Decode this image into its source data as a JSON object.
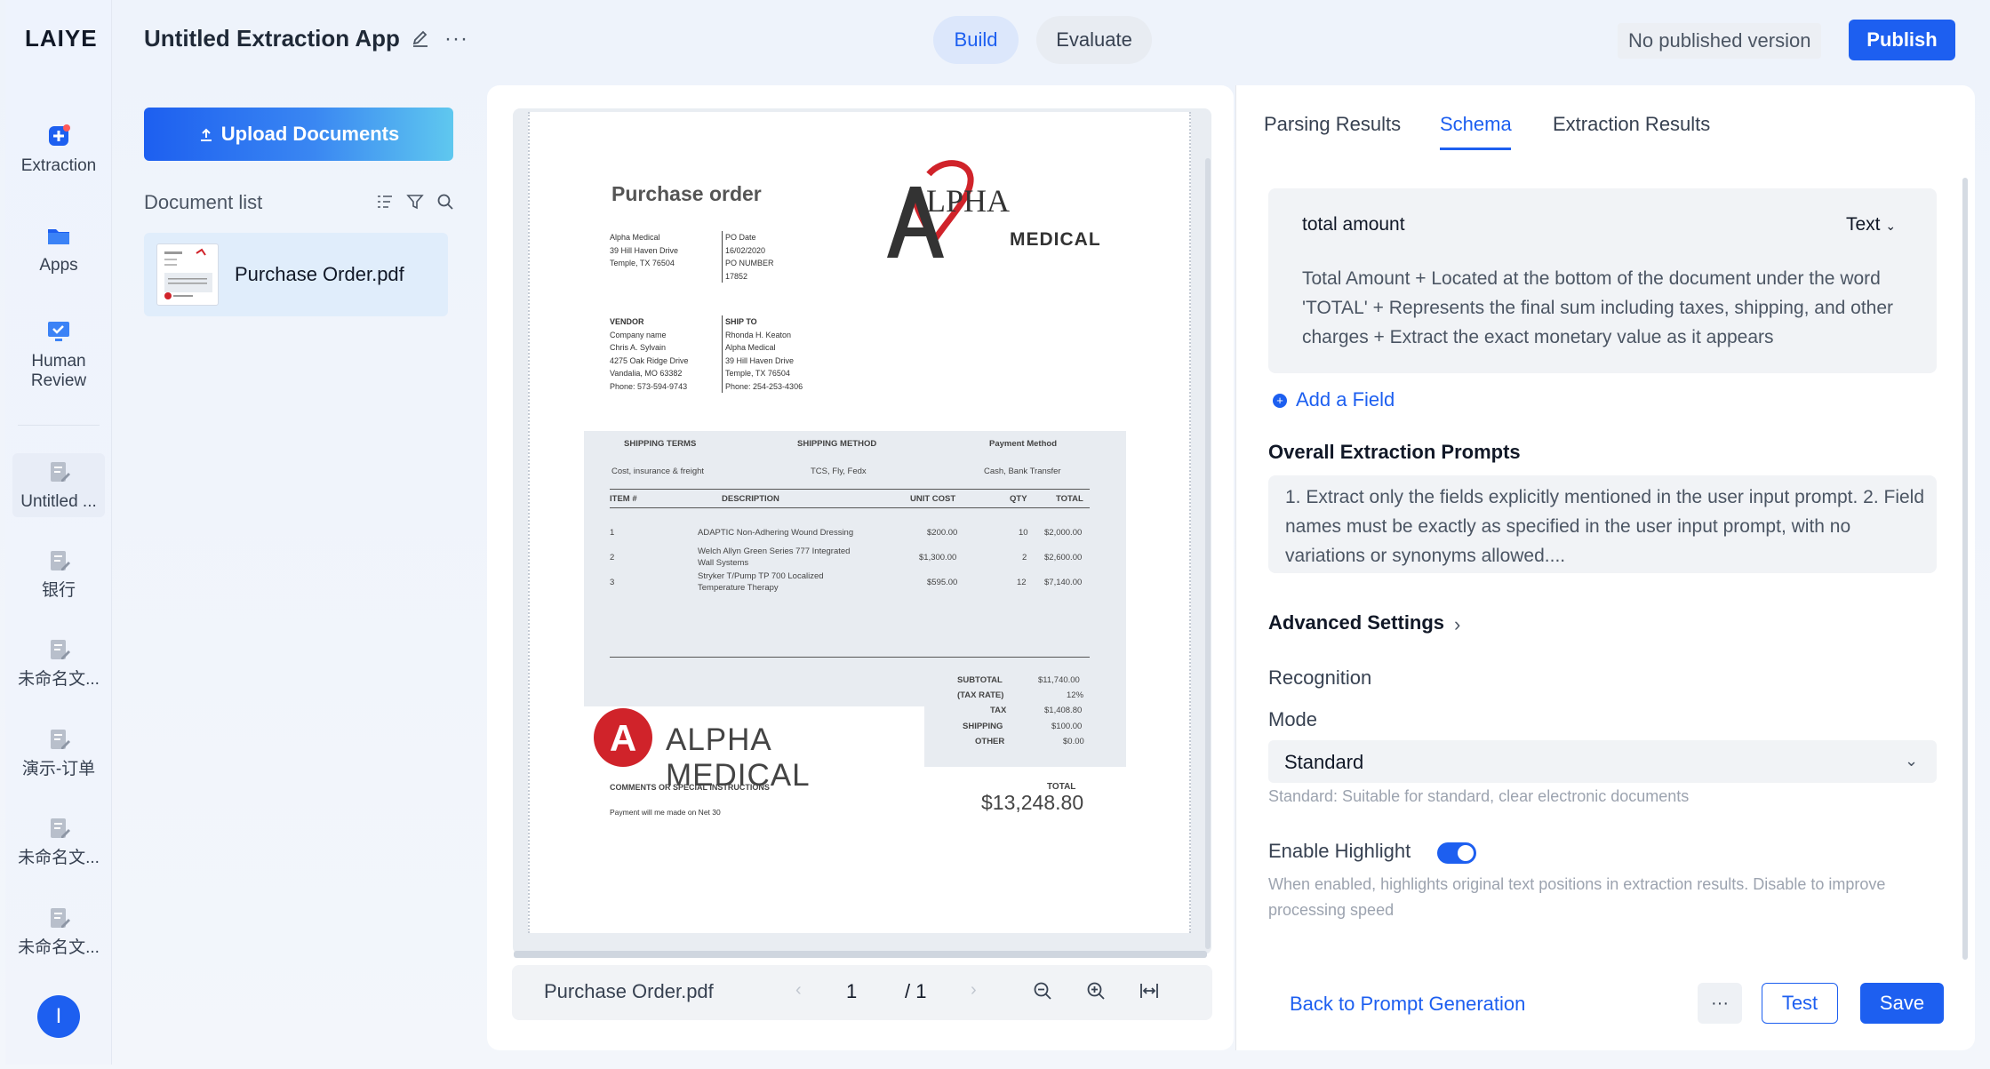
{
  "app": {
    "logo": "LAIYE",
    "title": "Untitled Extraction App",
    "build_tab": "Build",
    "evaluate_tab": "Evaluate",
    "no_published": "No published version",
    "publish": "Publish"
  },
  "rail": {
    "items": [
      {
        "label": "Extraction",
        "icon": "extraction-icon"
      },
      {
        "label": "Apps",
        "icon": "folder-icon"
      },
      {
        "label": "Human Review",
        "icon": "monitor-icon"
      },
      {
        "label": "Untitled ...",
        "icon": "doc-edit-icon"
      },
      {
        "label": "银行",
        "icon": "doc-edit-icon"
      },
      {
        "label": "未命名文...",
        "icon": "doc-edit-icon"
      },
      {
        "label": "演示-订单",
        "icon": "doc-edit-icon"
      },
      {
        "label": "未命名文...",
        "icon": "doc-edit-icon"
      },
      {
        "label": "未命名文...",
        "icon": "doc-edit-icon"
      }
    ],
    "avatar": "I"
  },
  "documents": {
    "upload_label": "Upload Documents",
    "list_label": "Document list",
    "items": [
      {
        "name": "Purchase Order.pdf"
      }
    ]
  },
  "viewer": {
    "file_name": "Purchase Order.pdf",
    "page": "1",
    "of": "/ 1",
    "prev": "‹",
    "next": "›",
    "doc": {
      "title": "Purchase order",
      "logo_alpha": "LPHA",
      "logo_medical": "MEDICAL",
      "from": [
        "Alpha Medical",
        "39 Hill Haven Drive",
        "Temple, TX 76504"
      ],
      "po": [
        "PO Date",
        "16/02/2020",
        "PO NUMBER",
        "17852"
      ],
      "vendor": [
        "VENDOR",
        "Company name",
        "Chris A. Sylvain",
        "4275 Oak Ridge Drive",
        "Vandalia, MO 63382",
        "Phone: 573-594-9743"
      ],
      "ship_to": [
        "SHIP TO",
        "Rhonda H. Keaton",
        "Alpha Medical",
        "39 Hill Haven Drive",
        "Temple, TX 76504",
        "Phone: 254-253-4306"
      ],
      "shipping_terms_h": "SHIPPING TERMS",
      "shipping_method_h": "SHIPPING METHOD",
      "payment_method_h": "Payment Method",
      "shipping_terms": "Cost, insurance & freight",
      "shipping_method": "TCS, Fly, Fedx",
      "payment_method": "Cash, Bank Transfer",
      "col_item": "ITEM #",
      "col_desc": "DESCRIPTION",
      "col_unit": "UNIT COST",
      "col_qty": "QTY",
      "col_total": "TOTAL",
      "rows": [
        {
          "item": "1",
          "desc1": "ADAPTIC Non-Adhering Wound Dressing",
          "desc2": "",
          "unit": "$200.00",
          "qty": "10",
          "total": "$2,000.00"
        },
        {
          "item": "2",
          "desc1": "Welch Allyn Green Series 777 Integrated",
          "desc2": "Wall Systems",
          "unit": "$1,300.00",
          "qty": "2",
          "total": "$2,600.00"
        },
        {
          "item": "3",
          "desc1": "Stryker T/Pump TP 700 Localized",
          "desc2": "Temperature Therapy",
          "unit": "$595.00",
          "qty": "12",
          "total": "$7,140.00"
        }
      ],
      "subtotal_l": "SUBTOTAL",
      "subtotal": "$11,740.00",
      "taxrate_l": "(TAX RATE)",
      "taxrate": "12%",
      "tax_l": "TAX",
      "tax": "$1,408.80",
      "shipping_l": "SHIPPING",
      "shipping": "$100.00",
      "other_l": "OTHER",
      "other": "$0.00",
      "banner_letter": "A",
      "banner_text": "ALPHA MEDICAL",
      "comments": "COMMENTS OR SPECIAL INSTRUCTIONS",
      "payment_note": "Payment will me made on Net 30",
      "total_l": "TOTAL",
      "total": "$13,248.80"
    }
  },
  "panel": {
    "tabs": [
      "Parsing Results",
      "Schema",
      "Extraction Results"
    ],
    "field": {
      "name": "total amount",
      "type": "Text",
      "description": "Total Amount + Located at the bottom of the document under the word 'TOTAL' + Represents the final sum including taxes, shipping, and other charges + Extract the exact monetary value as it appears"
    },
    "add_field": "Add a Field",
    "prompts_title": "Overall Extraction Prompts",
    "prompts_text": "1. Extract only the fields explicitly mentioned in the user input prompt. 2. Field names must be exactly as specified in the user input prompt, with no variations or synonyms allowed....",
    "advanced": "Advanced Settings",
    "recognition": "Recognition",
    "mode_label": "Mode",
    "mode_value": "Standard",
    "mode_hint": "Standard: Suitable for standard, clear electronic documents",
    "highlight_label": "Enable Highlight",
    "highlight_on": true,
    "highlight_hint": "When enabled, highlights original text positions in extraction results. Disable to improve processing speed",
    "back": "Back to Prompt Generation",
    "more": "···",
    "test": "Test",
    "save": "Save"
  },
  "colors": {
    "accent": "#1d5ff0",
    "brand_red": "#d0232a"
  }
}
